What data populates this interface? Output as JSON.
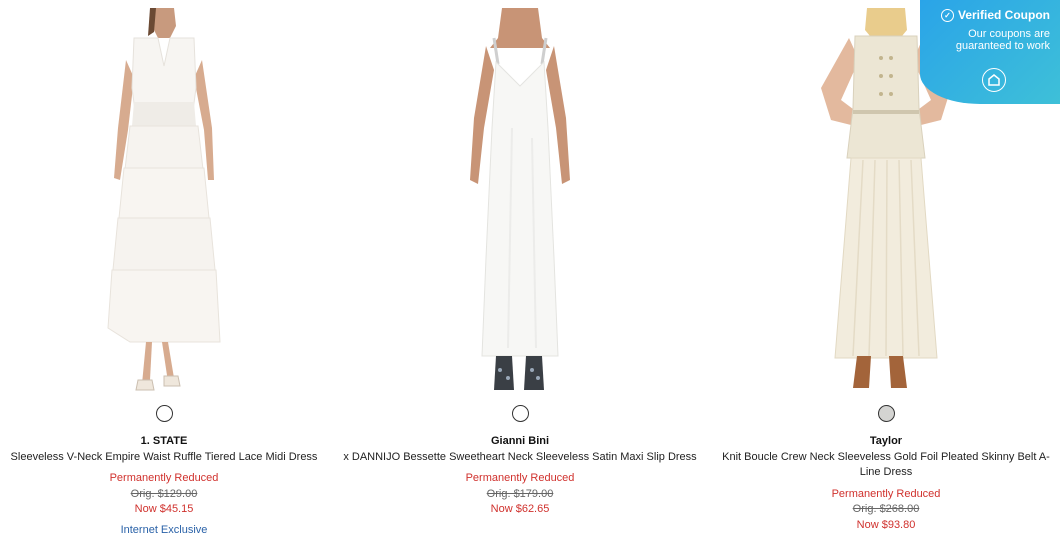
{
  "products": [
    {
      "brand": "1. STATE",
      "name": "Sleeveless V-Neck Empire Waist Ruffle Tiered Lace Midi Dress",
      "badge": "Permanently Reduced",
      "orig_price": "Orig. $129.00",
      "now_price": "Now $45.15",
      "exclusive": "Internet Exclusive",
      "swatch_color": "#ffffff"
    },
    {
      "brand": "Gianni Bini",
      "name": "x DANNIJO Bessette Sweetheart Neck Sleeveless Satin Maxi Slip Dress",
      "badge": "Permanently Reduced",
      "orig_price": "Orig. $179.00",
      "now_price": "Now $62.65",
      "swatch_color": "#ffffff"
    },
    {
      "brand": "Taylor",
      "name": "Knit Boucle Crew Neck Sleeveless Gold Foil Pleated Skinny Belt A-Line Dress",
      "badge": "Permanently Reduced",
      "orig_price": "Orig. $268.00",
      "now_price": "Now $93.80",
      "swatch_color": "#d4d4d2"
    }
  ],
  "coupon": {
    "title": "Verified Coupon",
    "subtitle": "Our coupons are guaranteed to work",
    "icon": "check-circle-icon",
    "logo_icon": "coupon-logo-icon"
  },
  "colors": {
    "sale_red": "#d0312d",
    "link_blue": "#2a62a8",
    "coupon_gradient_start": "#2aa4e8",
    "coupon_gradient_end": "#3ec0d8"
  }
}
